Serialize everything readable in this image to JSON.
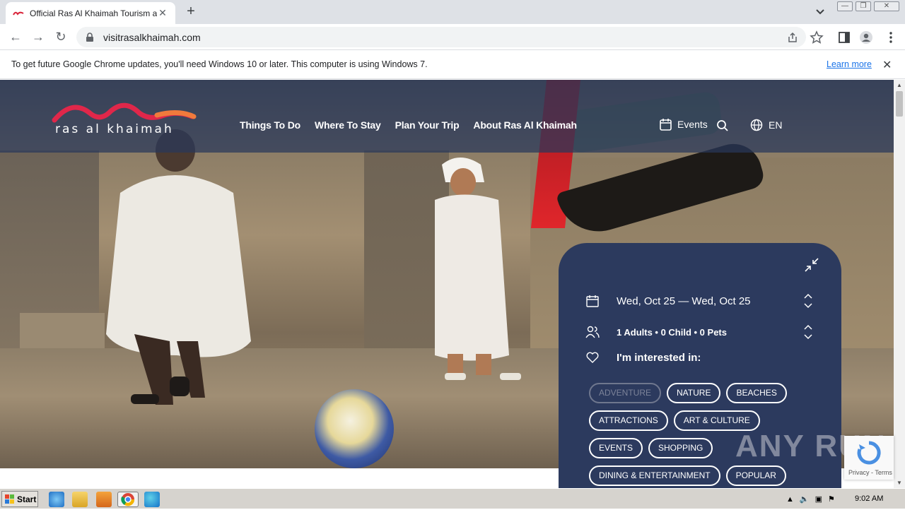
{
  "browser": {
    "tab_title": "Official Ras Al Khaimah Tourism and V",
    "new_tab_label": "+",
    "url": "visitrasalkhaimah.com"
  },
  "infobar": {
    "message": "To get future Google Chrome updates, you'll need Windows 10 or later. This computer is using Windows 7.",
    "link": "Learn more"
  },
  "site": {
    "logo_text": "ras al khaimah",
    "nav": [
      "Things To Do",
      "Where To Stay",
      "Plan Your Trip",
      "About Ras Al Khaimah"
    ],
    "events_label": "Events",
    "language": "EN"
  },
  "planner": {
    "dates": "Wed, Oct 25 — Wed, Oct 25",
    "guests": "1 Adults  •  0 Child  •  0 Pets",
    "interest_label": "I'm interested in:",
    "chips": [
      {
        "label": "ADVENTURE",
        "disabled": true
      },
      {
        "label": "NATURE",
        "disabled": false
      },
      {
        "label": "BEACHES",
        "disabled": false
      },
      {
        "label": "ATTRACTIONS",
        "disabled": false
      },
      {
        "label": "ART & CULTURE",
        "disabled": false
      },
      {
        "label": "EVENTS",
        "disabled": false
      },
      {
        "label": "SHOPPING",
        "disabled": false
      },
      {
        "label": "DINING & ENTERTAINMENT",
        "disabled": false
      },
      {
        "label": "POPULAR",
        "disabled": false
      }
    ]
  },
  "recaptcha": {
    "text": "Privacy - Terms"
  },
  "watermark": "ANY RUN",
  "taskbar": {
    "start_label": "Start",
    "clock": "9:02 AM"
  },
  "colors": {
    "header_overlay": "#28375a",
    "panel": "#2c3a5e",
    "logo_accent": "#e0274a",
    "logo_orange": "#f07a3c"
  }
}
